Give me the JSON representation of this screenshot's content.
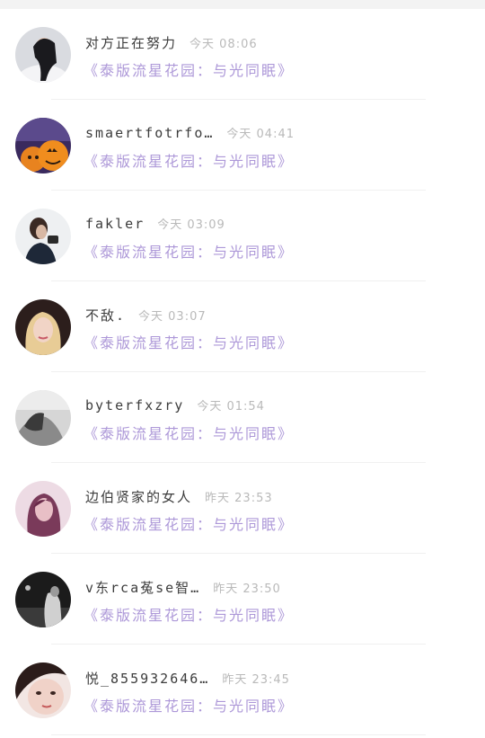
{
  "comments": [
    {
      "name": "对方正在努力",
      "time": "今天 08:06",
      "message": "《泰版流星花园：与光同眠》",
      "avatar_icon": "avatar-girl-white-shirt"
    },
    {
      "name": "smaertfotrfo…",
      "time": "今天 04:41",
      "message": "《泰版流星花园：与光同眠》",
      "avatar_icon": "avatar-pumpkin-lanterns"
    },
    {
      "name": "fakler",
      "time": "今天 03:09",
      "message": "《泰版流星花园：与光同眠》",
      "avatar_icon": "avatar-girl-camera"
    },
    {
      "name": "不敌.",
      "time": "今天 03:07",
      "message": "《泰版流星花园：与光同眠》",
      "avatar_icon": "avatar-blonde-girl"
    },
    {
      "name": "byterfxzry",
      "time": "今天 01:54",
      "message": "《泰版流星花园：与光同眠》",
      "avatar_icon": "avatar-bw-portrait"
    },
    {
      "name": "边伯贤家的女人",
      "time": "昨天 23:53",
      "message": "《泰版流星花园：与光同眠》",
      "avatar_icon": "avatar-pink-girl"
    },
    {
      "name": "v东rca菟se智…",
      "time": "昨天 23:50",
      "message": "《泰版流星花园：与光同眠》",
      "avatar_icon": "avatar-dark-street"
    },
    {
      "name": "悦_855932646…",
      "time": "昨天 23:45",
      "message": "《泰版流星花园：与光同眠》",
      "avatar_icon": "avatar-girl-closeup"
    }
  ]
}
